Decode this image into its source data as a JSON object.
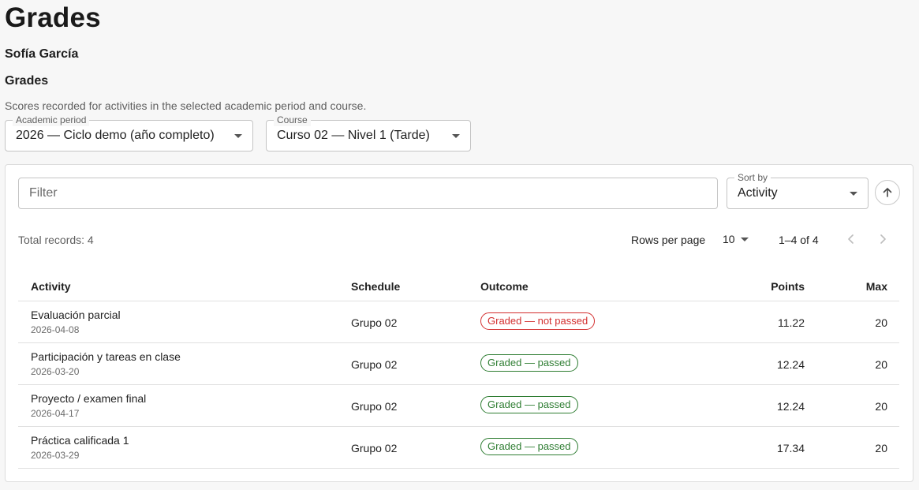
{
  "page": {
    "title": "Grades",
    "student_name": "Sofía García",
    "section_title": "Grades",
    "section_description": "Scores recorded for activities in the selected academic period and course."
  },
  "filters": {
    "academic_period": {
      "label": "Academic period",
      "value": "2026 — Ciclo demo (año completo)"
    },
    "course": {
      "label": "Course",
      "value": "Curso 02 — Nivel 1 (Tarde)"
    }
  },
  "toolbar": {
    "filter_placeholder": "Filter",
    "sort_by": {
      "label": "Sort by",
      "value": "Activity"
    },
    "sort_direction_icon": "arrow-up-icon"
  },
  "pagination": {
    "total_records": "Total records: 4",
    "rows_per_page_label": "Rows per page",
    "rows_per_page_value": "10",
    "range": "1–4 of 4"
  },
  "table": {
    "headers": {
      "activity": "Activity",
      "schedule": "Schedule",
      "outcome": "Outcome",
      "points": "Points",
      "max": "Max"
    },
    "rows": [
      {
        "activity": "Evaluación parcial",
        "date": "2026-04-08",
        "schedule": "Grupo 02",
        "outcome": "Graded — not passed",
        "status": "fail",
        "points": "11.22",
        "max": "20"
      },
      {
        "activity": "Participación y tareas en clase",
        "date": "2026-03-20",
        "schedule": "Grupo 02",
        "outcome": "Graded — passed",
        "status": "pass",
        "points": "12.24",
        "max": "20"
      },
      {
        "activity": "Proyecto / examen final",
        "date": "2026-04-17",
        "schedule": "Grupo 02",
        "outcome": "Graded — passed",
        "status": "pass",
        "points": "12.24",
        "max": "20"
      },
      {
        "activity": "Práctica calificada 1",
        "date": "2026-03-29",
        "schedule": "Grupo 02",
        "outcome": "Graded — passed",
        "status": "pass",
        "points": "17.34",
        "max": "20"
      }
    ]
  },
  "colors": {
    "fail": "#d32f2f",
    "pass": "#2e7d32"
  }
}
